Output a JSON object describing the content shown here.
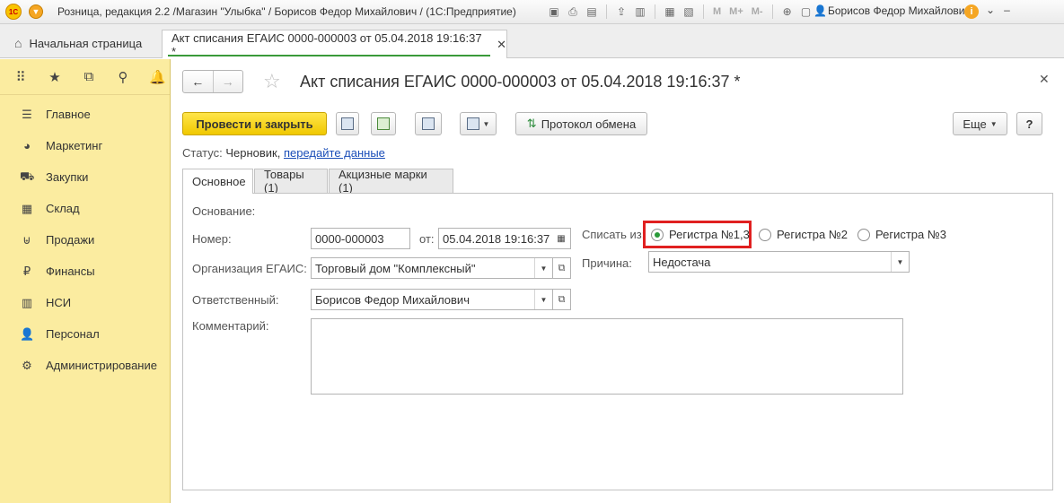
{
  "titlebar": {
    "logo_text": "1С",
    "app_title": "Розница, редакция 2.2 /Магазин \"Улыбка\" / Борисов Федор Михайлович / (1С:Предприятие)",
    "m_labels": [
      "M",
      "M+",
      "M-"
    ],
    "user_name": "Борисов Федор Михайлович"
  },
  "tabs": {
    "home_label": "Начальная страница",
    "doc_label": "Акт списания ЕГАИС 0000-000003 от 05.04.2018 19:16:37 *"
  },
  "sidebar": {
    "items": [
      {
        "label": "Главное",
        "icon": "menu-lines-icon"
      },
      {
        "label": "Маркетинг",
        "icon": "pie-chart-icon"
      },
      {
        "label": "Закупки",
        "icon": "cart-icon"
      },
      {
        "label": "Склад",
        "icon": "warehouse-icon"
      },
      {
        "label": "Продажи",
        "icon": "shopping-basket-icon"
      },
      {
        "label": "Финансы",
        "icon": "ruble-coin-icon"
      },
      {
        "label": "НСИ",
        "icon": "books-icon"
      },
      {
        "label": "Персонал",
        "icon": "person-icon"
      },
      {
        "label": "Администрирование",
        "icon": "gear-icon"
      }
    ]
  },
  "form": {
    "title": "Акт списания ЕГАИС 0000-000003 от 05.04.2018 19:16:37 *",
    "primary_button": "Провести и закрыть",
    "protocol_button": "Протокол обмена",
    "more_button": "Еще",
    "help_button": "?",
    "status_label": "Статус:",
    "status_value": "Черновик,",
    "status_link": "передайте данные",
    "tabs": [
      "Основное",
      "Товары (1)",
      "Акцизные марки (1)"
    ],
    "labels": {
      "basis": "Основание:",
      "number": "Номер:",
      "from": "от:",
      "org": "Организация ЕГАИС:",
      "responsible": "Ответственный:",
      "comment": "Комментарий:",
      "write_off_from": "Списать из:",
      "reason": "Причина:"
    },
    "values": {
      "number": "0000-000003",
      "date": "05.04.2018 19:16:37",
      "org": "Торговый дом \"Комплексный\"",
      "responsible": "Борисов Федор Михайлович",
      "reason": "Недостача"
    },
    "radio_options": [
      "Регистра №1,3",
      "Регистра №2",
      "Регистра №3"
    ],
    "radio_selected": 0
  }
}
